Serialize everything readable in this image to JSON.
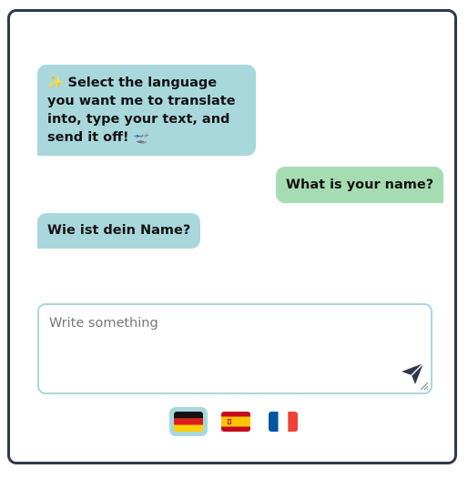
{
  "chat": {
    "messages": [
      {
        "role": "bot",
        "lead_emoji": "✨",
        "text": "Select the language you want me to translate into, type your text, and send it off!",
        "trail_emoji": "🛫"
      },
      {
        "role": "user",
        "text": "What is your name?"
      },
      {
        "role": "bot",
        "text": "Wie ist dein Name?"
      }
    ]
  },
  "composer": {
    "placeholder": "Write something",
    "value": "",
    "send_icon": "paper-plane-icon"
  },
  "languages": {
    "selected": "de",
    "options": [
      {
        "code": "de",
        "icon": "germany-flag-icon"
      },
      {
        "code": "es",
        "icon": "spain-flag-icon"
      },
      {
        "code": "fr",
        "icon": "france-flag-icon"
      }
    ]
  },
  "colors": {
    "bot_bubble": "#a8d8dc",
    "user_bubble": "#a6dcb2",
    "frame_border": "#2e3a4b",
    "input_border": "#a8d8dc"
  }
}
